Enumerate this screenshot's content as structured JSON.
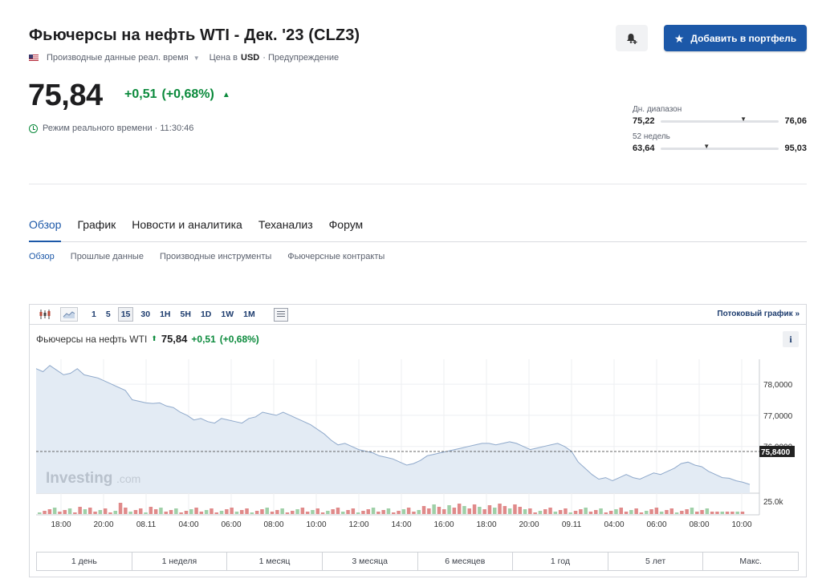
{
  "header": {
    "title": "Фьючерсы на нефть WTI - Дек. '23 (CLZ3)",
    "data_type": "Производные данные реал. время",
    "currency_prefix": "Цена в",
    "currency": "USD",
    "warning": "· Предупреждение",
    "add_portfolio_label": "Добавить в портфель"
  },
  "quote": {
    "price": "75,84",
    "change": "+0,51",
    "change_pct": "(+0,68%)",
    "realtime_label": "Режим реального времени · 11:30:46"
  },
  "ranges": {
    "day": {
      "label": "Дн. диапазон",
      "low": "75,22",
      "high": "76,06",
      "position": 0.7
    },
    "week52": {
      "label": "52 недель",
      "low": "63,64",
      "high": "95,03",
      "position": 0.39
    }
  },
  "tabs": [
    "Обзор",
    "График",
    "Новости и аналитика",
    "Теханализ",
    "Форум"
  ],
  "subtabs": [
    "Обзор",
    "Прошлые данные",
    "Производные инструменты",
    "Фьючерсные контракты"
  ],
  "chart_widget": {
    "intervals": [
      "1",
      "5",
      "15",
      "30",
      "1H",
      "5H",
      "1D",
      "1W",
      "1M"
    ],
    "selected_interval": "15",
    "streaming_label": "Потоковый график »",
    "legend_name": "Фьючерсы на нефть WTI",
    "legend_price": "75,84",
    "legend_change": "+0,51",
    "legend_change_pct": "(+0,68%)",
    "info_label": "i",
    "watermark": "Investing",
    "watermark_suffix": ".com",
    "periods": [
      "1 день",
      "1 неделя",
      "1 месяц",
      "3 месяца",
      "6 месяцев",
      "1 год",
      "5 лет",
      "Макс."
    ]
  },
  "chart_data": {
    "type": "area",
    "series_name": "Фьючерсы на нефть WTI",
    "y_ticks": [
      "78,0000",
      "77,0000",
      "76,0000"
    ],
    "y_tick_values": [
      78,
      77,
      76
    ],
    "volume_tick": "25.0k",
    "ylim": [
      74.5,
      78.8
    ],
    "current_label": "75,8400",
    "current_value": 75.84,
    "x_labels": [
      "18:00",
      "20:00",
      "08.11",
      "04:00",
      "06:00",
      "08:00",
      "10:00",
      "12:00",
      "14:00",
      "16:00",
      "18:00",
      "20:00",
      "09.11",
      "04:00",
      "06:00",
      "08:00",
      "10:00"
    ],
    "values": [
      78.5,
      78.4,
      78.6,
      78.45,
      78.3,
      78.35,
      78.5,
      78.3,
      78.25,
      78.2,
      78.1,
      78.0,
      77.9,
      77.8,
      77.5,
      77.45,
      77.4,
      77.38,
      77.4,
      77.3,
      77.25,
      77.1,
      77.0,
      76.85,
      76.9,
      76.8,
      76.75,
      76.9,
      76.85,
      76.8,
      76.75,
      76.9,
      76.95,
      77.1,
      77.05,
      77.0,
      77.1,
      77.0,
      76.9,
      76.8,
      76.7,
      76.55,
      76.4,
      76.2,
      76.05,
      76.1,
      76.0,
      75.9,
      75.85,
      75.8,
      75.7,
      75.65,
      75.6,
      75.5,
      75.4,
      75.45,
      75.55,
      75.7,
      75.75,
      75.8,
      75.85,
      75.9,
      75.95,
      76.0,
      76.05,
      76.1,
      76.1,
      76.05,
      76.1,
      76.15,
      76.1,
      76.0,
      75.9,
      75.95,
      76.0,
      76.05,
      76.1,
      76.0,
      75.85,
      75.5,
      75.3,
      75.1,
      74.95,
      75.0,
      74.9,
      75.0,
      75.1,
      75.0,
      74.95,
      75.05,
      75.15,
      75.1,
      75.2,
      75.3,
      75.45,
      75.5,
      75.4,
      75.35,
      75.2,
      75.1,
      75.0,
      74.98,
      74.9,
      74.85,
      74.78
    ],
    "volume": []
  }
}
